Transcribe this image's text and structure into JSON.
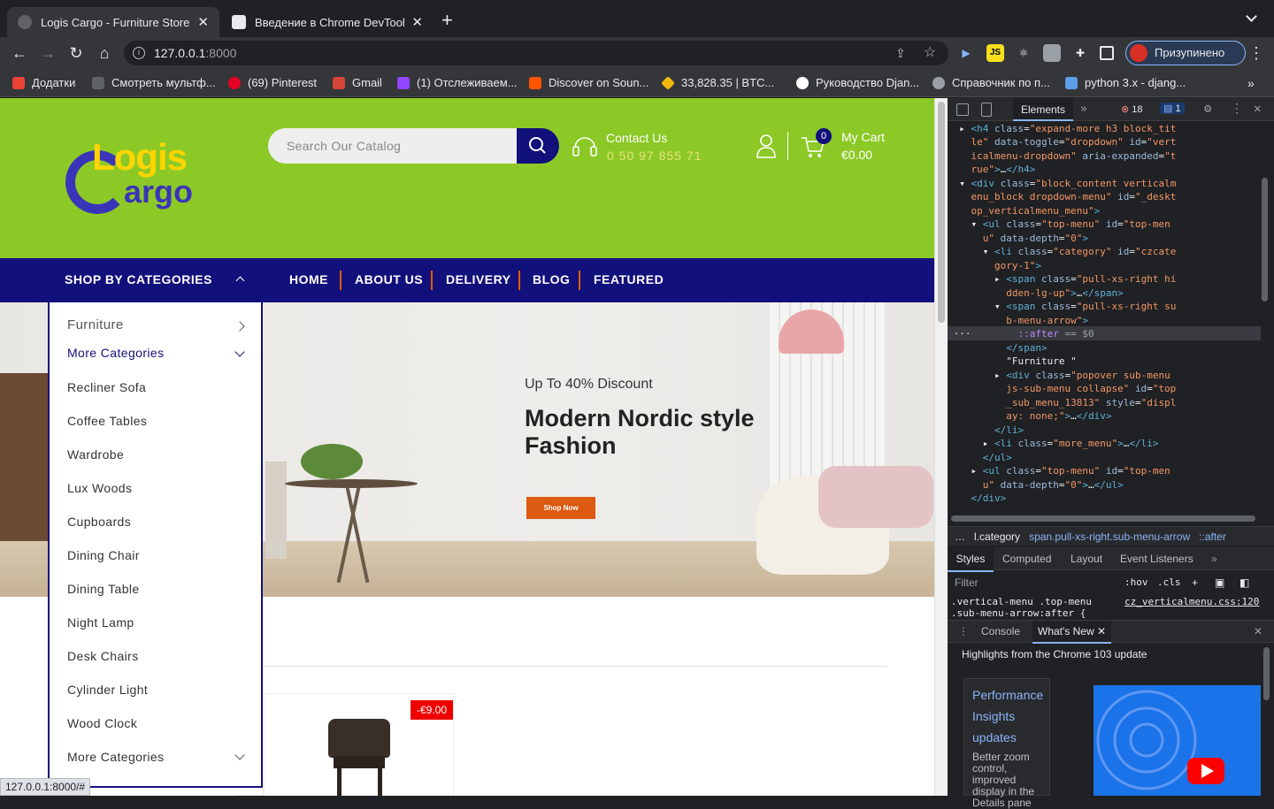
{
  "browser": {
    "tabs": [
      {
        "title": "Logis Cargo - Furniture Store",
        "active": true
      },
      {
        "title": "Введение в Chrome DevTools.",
        "active": false
      }
    ],
    "new_tab": "+",
    "url_host": "127.0.0.1",
    "url_port": ":8000",
    "profile_label": "Призупинено",
    "bookmarks": [
      "Додатки",
      "Смотреть мультф...",
      "(69) Pinterest",
      "Gmail",
      "(1) Отслеживаем...",
      "Discover on Soun...",
      "33,828.35 | BTC...",
      "Руководство Djan...",
      "Справочник по п...",
      "python 3.x - djang..."
    ],
    "status_url": "127.0.0.1:8000/#"
  },
  "site": {
    "logo_top": "Logis",
    "logo_bottom": "argo",
    "search_placeholder": "Search Our Catalog",
    "contact_label": "Contact Us",
    "contact_phone": "0 50 97 855 71",
    "cart_count": "0",
    "cart_label": "My Cart",
    "cart_total": "€0.00",
    "shop_by_categories": "SHOP BY CATEGORIES",
    "nav": [
      "HOME",
      "ABOUT US",
      "DELIVERY",
      "BLOG",
      "FEATURED"
    ],
    "categories": [
      "Furniture",
      "More Categories",
      "Recliner Sofa",
      "Coffee Tables",
      "Wardrobe",
      "Lux Woods",
      "Cupboards",
      "Dining Chair",
      "Dining Table",
      "Night Lamp",
      "Desk Chairs",
      "Cylinder Light",
      "Wood Clock",
      "More Categories"
    ],
    "banner_subtitle": "Up To 40% Discount",
    "banner_title": "Modern Nordic style Fashion",
    "banner_button": "Shop Now",
    "discount_badge": "-€9.00",
    "colors": {
      "header_green": "#8cc927",
      "navy": "#12107a",
      "orange": "#dd5a11"
    }
  },
  "devtools": {
    "panel": "Elements",
    "errors": "18",
    "messages": "1",
    "breadcrumbs": [
      "…",
      "l.category",
      "span.pull-xs-right.sub-menu-arrow",
      "::after"
    ],
    "style_tabs": [
      "Styles",
      "Computed",
      "Layout",
      "Event Listeners"
    ],
    "filter_placeholder": "Filter",
    "hov": ":hov",
    "cls": ".cls",
    "rule_selector": ".vertical-menu .top-menu\n.sub-menu-arrow:after {",
    "rule_file": "cz_verticalmenu.css:120",
    "drawer_tabs": [
      "Console",
      "What's New"
    ],
    "highlights": "Highlights from the Chrome 103 update",
    "card_title": "Performance Insights updates",
    "card_desc": "Better zoom control, improved display in the Details pane"
  }
}
